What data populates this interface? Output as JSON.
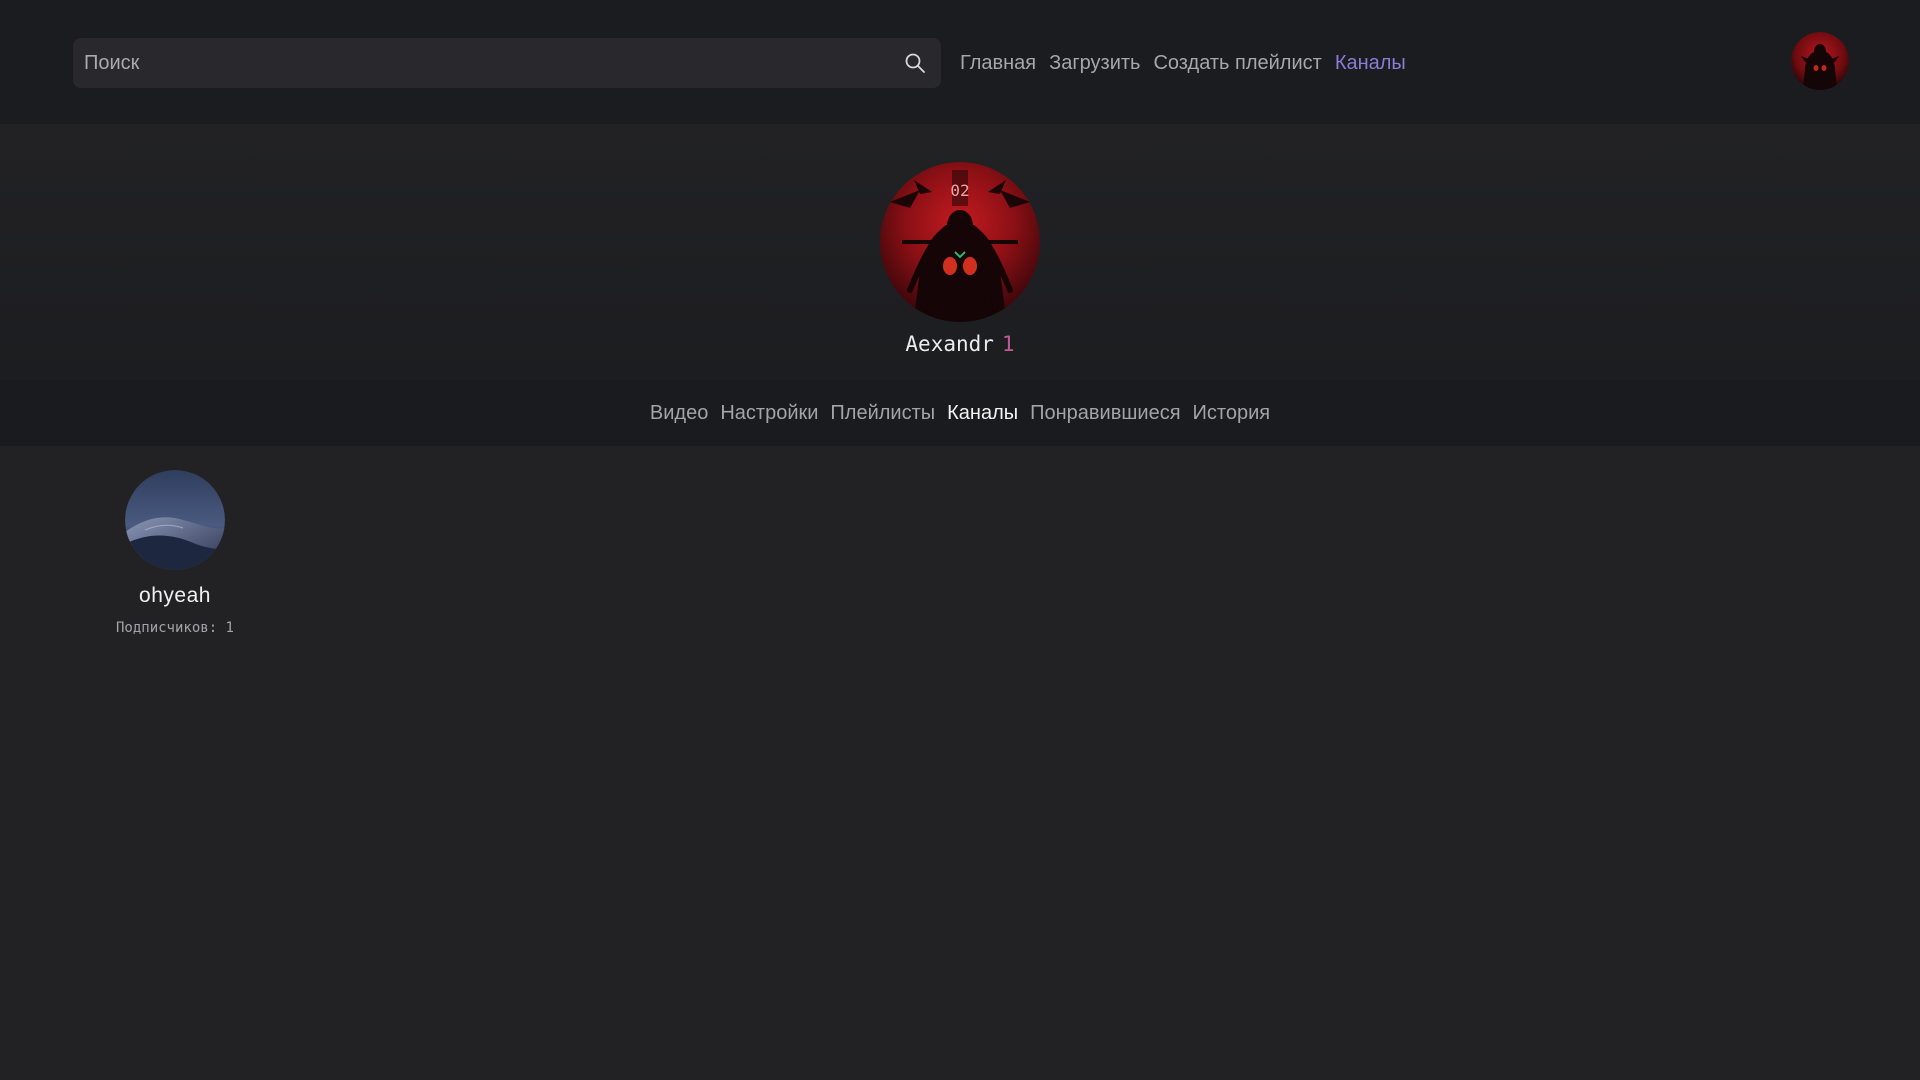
{
  "header": {
    "search": {
      "placeholder": "Поиск",
      "value": ""
    },
    "nav": [
      {
        "label": "Главная",
        "active": false
      },
      {
        "label": "Загрузить",
        "active": false
      },
      {
        "label": "Создать плейлист",
        "active": false
      },
      {
        "label": "Каналы",
        "active": true
      }
    ],
    "active_color": "#8c7bd4"
  },
  "profile": {
    "name": "Aexandr",
    "count": "1",
    "count_color": "#c05a95"
  },
  "tabs": [
    {
      "label": "Видео",
      "active": false
    },
    {
      "label": "Настройки",
      "active": false
    },
    {
      "label": "Плейлисты",
      "active": false
    },
    {
      "label": "Каналы",
      "active": true
    },
    {
      "label": "Понравившиеся",
      "active": false
    },
    {
      "label": "История",
      "active": false
    }
  ],
  "channels": [
    {
      "name": "ohyeah",
      "subscribers_label": "Подписчиков: 1"
    }
  ],
  "icons": {
    "search": "search-icon",
    "avatar": "user-avatar",
    "channel_avatar": "desert-dune-avatar"
  }
}
